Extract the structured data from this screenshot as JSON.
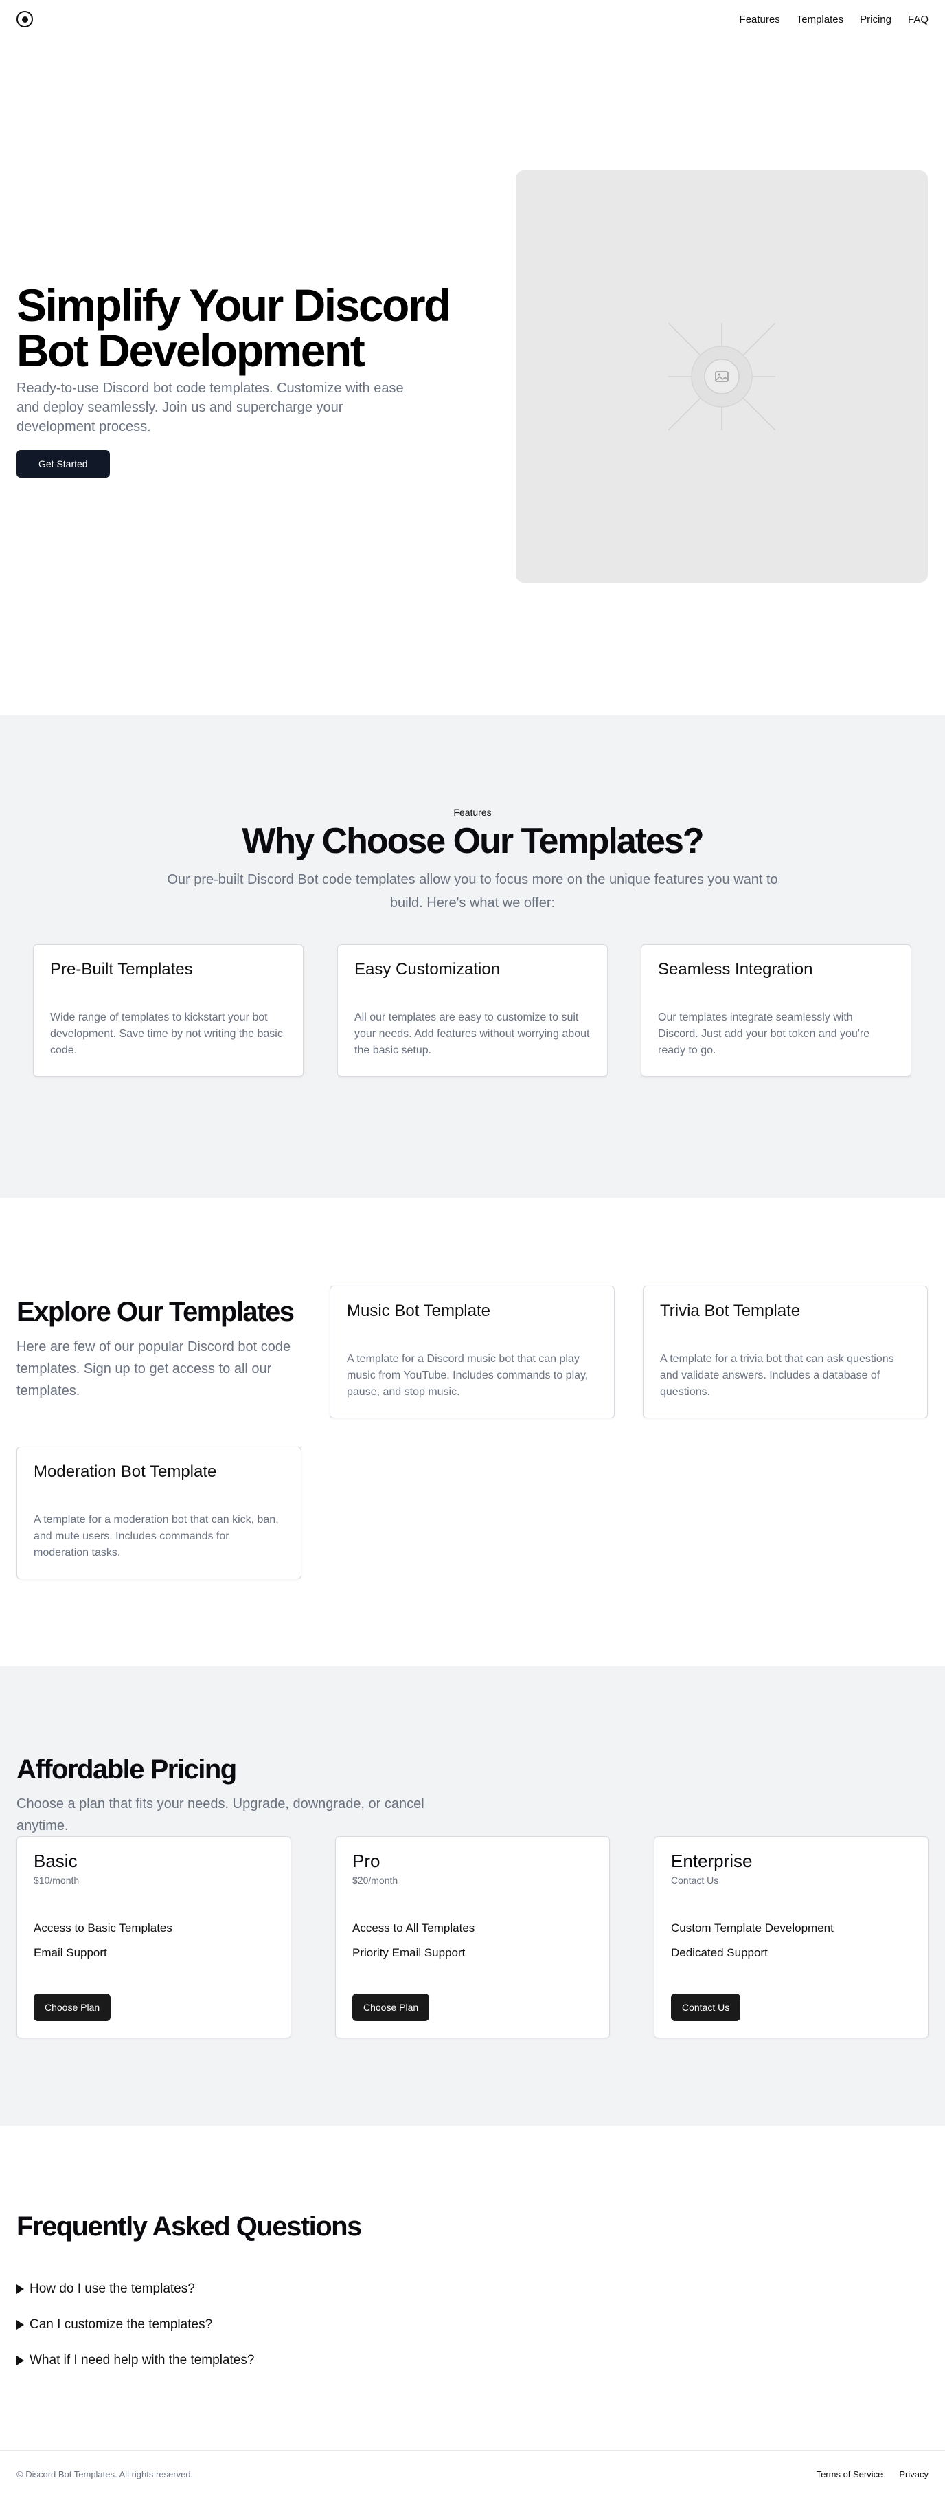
{
  "header": {
    "nav": [
      "Features",
      "Templates",
      "Pricing",
      "FAQ"
    ]
  },
  "hero": {
    "title": "Simplify Your Discord Bot Development",
    "subtitle": "Ready-to-use Discord bot code templates. Customize with ease and deploy seamlessly. Join us and supercharge your development process.",
    "cta": "Get Started",
    "image_icon": "image-placeholder-icon"
  },
  "features": {
    "eyebrow": "Features",
    "title": "Why Choose Our Templates?",
    "subtitle": "Our pre-built Discord Bot code templates allow you to focus more on the unique features you want to build. Here's what we offer:",
    "cards": [
      {
        "title": "Pre-Built Templates",
        "desc": "Wide range of templates to kickstart your bot development. Save time by not writing the basic code."
      },
      {
        "title": "Easy Customization",
        "desc": "All our templates are easy to customize to suit your needs. Add features without worrying about the basic setup."
      },
      {
        "title": "Seamless Integration",
        "desc": "Our templates integrate seamlessly with Discord. Just add your bot token and you're ready to go."
      }
    ]
  },
  "templates": {
    "title": "Explore Our Templates",
    "subtitle": "Here are few of our popular Discord bot code templates. Sign up to get access to all our templates.",
    "cards": [
      {
        "title": "Music Bot Template",
        "desc": "A template for a Discord music bot that can play music from YouTube. Includes commands to play, pause, and stop music."
      },
      {
        "title": "Trivia Bot Template",
        "desc": "A template for a trivia bot that can ask questions and validate answers. Includes a database of questions."
      },
      {
        "title": "Moderation Bot Template",
        "desc": "A template for a moderation bot that can kick, ban, and mute users. Includes commands for moderation tasks."
      }
    ]
  },
  "pricing": {
    "title": "Affordable Pricing",
    "subtitle": "Choose a plan that fits your needs. Upgrade, downgrade, or cancel anytime.",
    "plans": [
      {
        "name": "Basic",
        "price": "$10/month",
        "features": [
          "Access to Basic Templates",
          "Email Support"
        ],
        "cta": "Choose Plan"
      },
      {
        "name": "Pro",
        "price": "$20/month",
        "features": [
          "Access to All Templates",
          "Priority Email Support"
        ],
        "cta": "Choose Plan"
      },
      {
        "name": "Enterprise",
        "price": "Contact Us",
        "features": [
          "Custom Template Development",
          "Dedicated Support"
        ],
        "cta": "Contact Us"
      }
    ]
  },
  "faq": {
    "title": "Frequently Asked Questions",
    "items": [
      "How do I use the templates?",
      "Can I customize the templates?",
      "What if I need help with the templates?"
    ]
  },
  "footer": {
    "copyright": "© Discord Bot Templates. All rights reserved.",
    "links": [
      "Terms of Service",
      "Privacy"
    ]
  },
  "colors": {
    "accent_dark": "#111827",
    "muted_text": "#6b7280",
    "section_gray": "#f2f3f5"
  }
}
